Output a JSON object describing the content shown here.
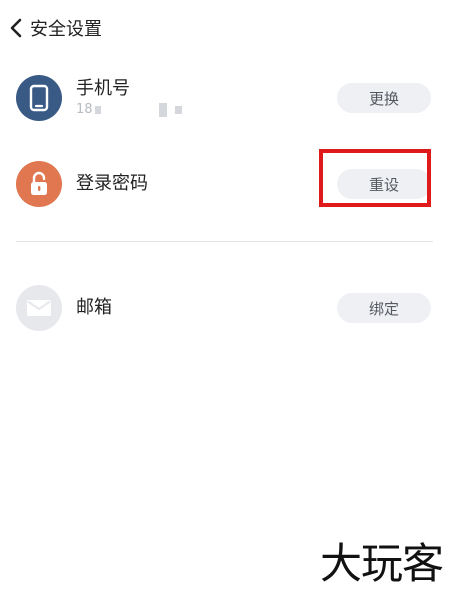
{
  "header": {
    "title": "安全设置",
    "back_icon": "chevron-left-icon"
  },
  "items": [
    {
      "icon": "phone-icon",
      "icon_color": "#3a5a86",
      "title": "手机号",
      "subtitle": "18",
      "action": "更换"
    },
    {
      "icon": "lock-icon",
      "icon_color": "#e07750",
      "title": "登录密码",
      "action": "重设"
    },
    {
      "icon": "mail-icon",
      "icon_color": "#e6e8ec",
      "title": "邮箱",
      "action": "绑定"
    }
  ],
  "highlight_color": "#e01a1a",
  "watermark": "大玩客"
}
